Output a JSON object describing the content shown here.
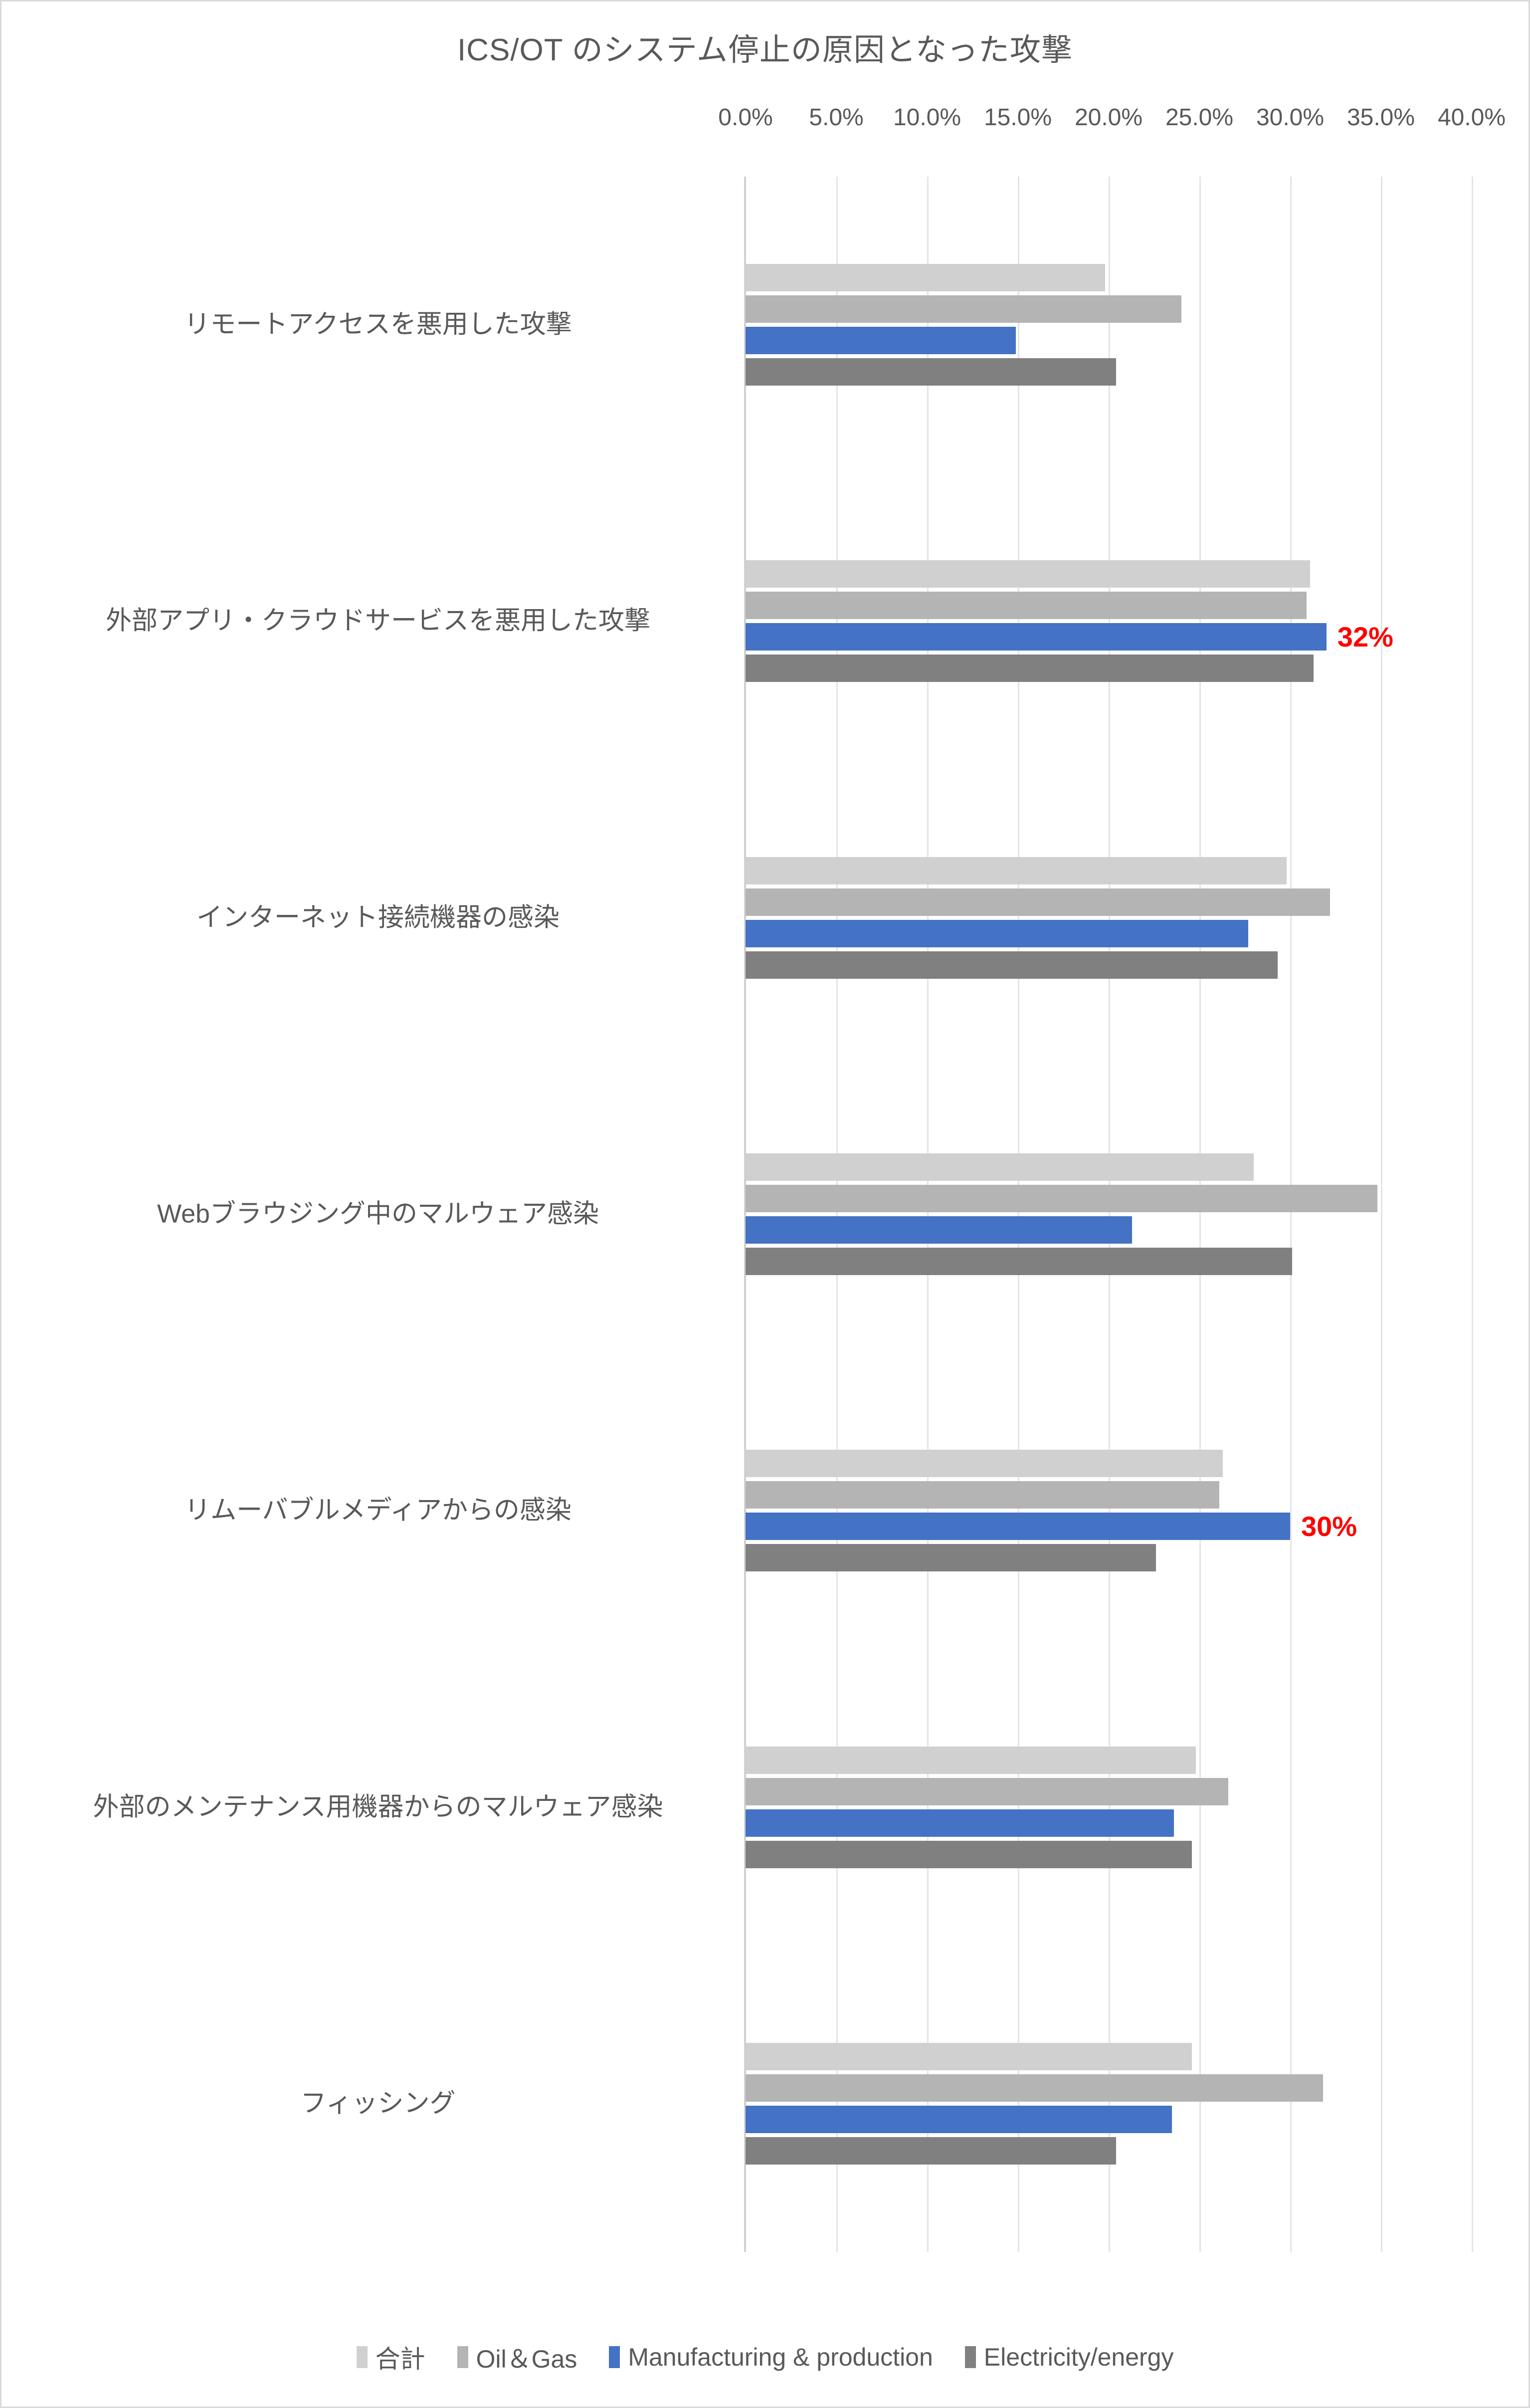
{
  "chart_data": {
    "type": "bar",
    "orientation": "horizontal",
    "grouped": true,
    "title": "ICS/OT のシステム停止の原因となった攻撃",
    "xlabel": "",
    "ylabel": "",
    "xlim": [
      0,
      40
    ],
    "xtick_labels": [
      "0.0%",
      "5.0%",
      "10.0%",
      "15.0%",
      "20.0%",
      "25.0%",
      "30.0%",
      "35.0%",
      "40.0%"
    ],
    "xtick_values": [
      0,
      5,
      10,
      15,
      20,
      25,
      30,
      35,
      40
    ],
    "grid": true,
    "legend_position": "bottom",
    "categories": [
      "リモートアクセスを悪用した攻撃",
      "外部アプリ・クラウドサービスを悪用した攻撃",
      "インターネット接続機器の感染",
      "Webブラウジング中のマルウェア感染",
      "リムーバブルメディアからの感染",
      "外部のメンテナンス用機器からのマルウェア感染",
      "フィッシング"
    ],
    "series": [
      {
        "name": "合計",
        "color": "#d0d0d0",
        "values": [
          19.8,
          31.1,
          29.8,
          28.0,
          26.3,
          24.8,
          24.6
        ]
      },
      {
        "name": "Oil＆Gas",
        "color": "#b4b4b4",
        "values": [
          24.0,
          30.9,
          32.2,
          34.8,
          26.1,
          26.6,
          31.8
        ]
      },
      {
        "name": "Manufacturing & production",
        "color": "#4472c4",
        "values": [
          14.9,
          32.0,
          27.7,
          21.3,
          30.0,
          23.6,
          23.5
        ]
      },
      {
        "name": "Electricity/energy",
        "color": "#808080",
        "values": [
          20.4,
          31.3,
          29.3,
          30.1,
          22.6,
          24.6,
          20.4
        ]
      }
    ],
    "data_labels": [
      {
        "category_index": 1,
        "series_index": 2,
        "text": "32%",
        "color": "#ff0000"
      },
      {
        "category_index": 4,
        "series_index": 2,
        "text": "30%",
        "color": "#ff0000"
      }
    ]
  }
}
